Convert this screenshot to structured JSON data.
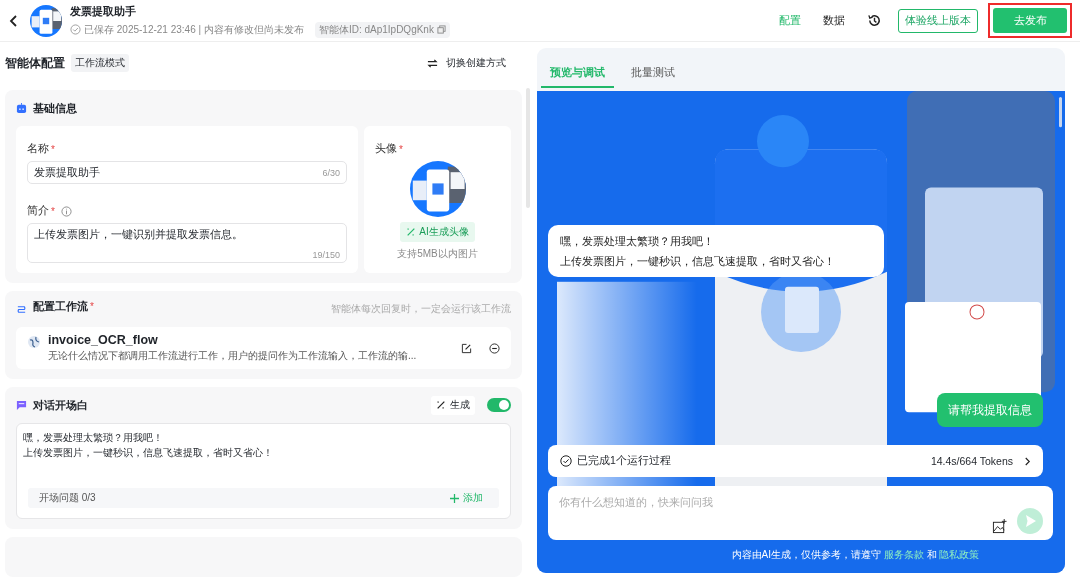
{
  "header": {
    "title": "发票提取助手",
    "saved": "已保存 2025-12-21 23:46 | 内容有修改但尚未发布",
    "agent_id": "智能体ID: dAp1IpDQgKnk",
    "nav": [
      {
        "label": "配置",
        "selected": true
      },
      {
        "label": "数据",
        "selected": false
      }
    ],
    "try_button": "体验线上版本",
    "publish_button": {
      "label": "去发布",
      "highlighted": true
    }
  },
  "config": {
    "title": "智能体配置",
    "mode_tag": "工作流模式",
    "switch_label": "切换创建方式",
    "basic": {
      "title": "基础信息",
      "name_label": {
        "text": "名称",
        "required_mark": "*"
      },
      "name_value": "发票提取助手",
      "name_count": "6/30",
      "intro_label": {
        "text": "简介",
        "required_mark": "*"
      },
      "intro_value": "上传发票图片，一键识别并提取发票信息。",
      "intro_count": "19/150",
      "avatar_label": {
        "text": "头像",
        "required_mark": "*"
      },
      "ai_avatar_button": "AI生成头像",
      "avatar_hint": "支持5MB以内图片"
    },
    "workflow": {
      "title": {
        "text": "配置工作流",
        "required_mark": "*"
      },
      "hint": "智能体每次回复时，一定会运行该工作流",
      "name": "invoice_OCR_flow",
      "description": "无论什么情况下都调用工作流进行工作，用户的提问作为工作流输入，工作流的输..."
    },
    "opening": {
      "title": "对话开场白",
      "generate_label": "生成",
      "enabled": true,
      "text_lines": [
        "嘿，发票处理太繁琐？用我吧！",
        "上传发票图片，一键秒识，信息飞速提取，省时又省心！"
      ],
      "questions_label": "开场问题 0/3",
      "add_label": "添加"
    }
  },
  "preview": {
    "tabs": [
      {
        "label": "预览与调试",
        "selected": true
      },
      {
        "label": "批量测试",
        "selected": false
      }
    ],
    "messages": [
      {
        "kind": "bot",
        "lines": [
          "嘿，发票处理太繁琐？用我吧！",
          "上传发票图片，一键秒识，信息飞速提取，省时又省心！"
        ]
      },
      {
        "kind": "user",
        "lines": [
          "请帮我提取信息"
        ]
      }
    ],
    "run_status": "已完成1个运行过程",
    "run_stats": "14.4s/664 Tokens",
    "input_placeholder": "你有什么想知道的，快来问问我",
    "footer": {
      "text": "内容由AI生成，仅供参考，请遵守",
      "terms": "服务条款",
      "and": "和",
      "privacy": "隐私政策"
    }
  }
}
